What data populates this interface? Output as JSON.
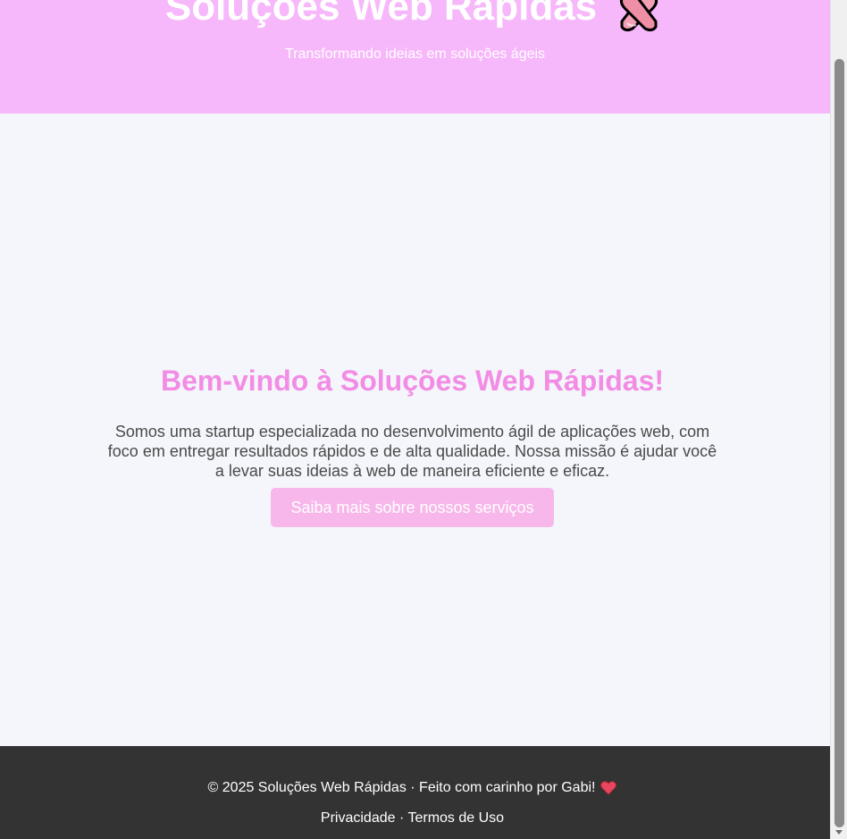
{
  "header": {
    "title": "Soluções Web Rápidas",
    "title_icon": "ballet-shoes-icon",
    "subtitle": "Transformando ideias em soluções ágeis"
  },
  "hero": {
    "title": "Bem-vindo à Soluções Web Rápidas!",
    "text": "Somos uma startup especializada no desenvolvimento ágil de aplicações web, com foco em entregar resultados rápidos e de alta qualidade. Nossa missão é ajudar você a levar suas ideias à web de maneira eficiente e eficaz.",
    "cta_label": "Saiba mais sobre nossos serviços"
  },
  "footer": {
    "copyright": "© 2025 Soluções Web Rápidas · Feito com carinho por Gabi!",
    "heart_icon": "heart-icon",
    "privacy_label": "Privacidade",
    "separator": "·",
    "terms_label": "Termos de Uso"
  },
  "colors": {
    "header_bg": "#f7b7fb",
    "accent": "#f28ce4",
    "button_bg": "#f7b7ea",
    "footer_bg": "#333333",
    "page_bg": "#f4f6fb"
  }
}
